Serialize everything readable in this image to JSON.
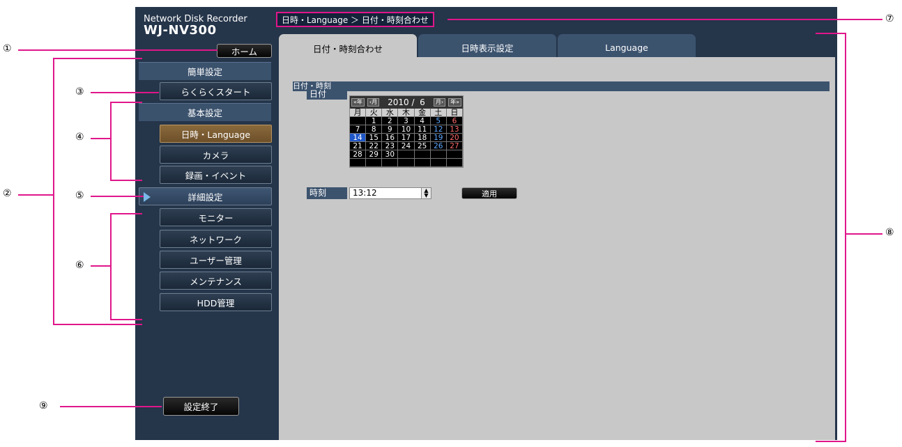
{
  "product": {
    "name": "Network Disk Recorder",
    "model": "WJ-NV300"
  },
  "breadcrumb": "日時・Language ＞ 日付・時刻合わせ",
  "home_button": "ホーム",
  "sidebar": {
    "cat_simple": "簡単設定",
    "quick_start": "らくらくスタート",
    "cat_basic": "基本設定",
    "datetime_language": "日時・Language",
    "camera": "カメラ",
    "recording_event": "録画・イベント",
    "cat_advanced": "詳細設定",
    "monitor": "モニター",
    "network": "ネットワーク",
    "user_management": "ユーザー管理",
    "maintenance": "メンテナンス",
    "hdd_management": "HDD管理"
  },
  "finish_button": "設定終了",
  "tabs": [
    "日付・時刻合わせ",
    "日時表示設定",
    "Language"
  ],
  "section_title": "日付・時刻",
  "date_label": "日付",
  "calendar": {
    "nav_prev_year": "«年",
    "nav_prev_month": "‹月",
    "year_month": "2010 /  6",
    "nav_next_month": "月›",
    "nav_next_year": "年»",
    "weekdays": [
      "月",
      "火",
      "水",
      "木",
      "金",
      "土",
      "日"
    ],
    "weeks": [
      [
        "",
        "1",
        "2",
        "3",
        "4",
        "5",
        "6"
      ],
      [
        "7",
        "8",
        "9",
        "10",
        "11",
        "12",
        "13"
      ],
      [
        "14",
        "15",
        "16",
        "17",
        "18",
        "19",
        "20"
      ],
      [
        "21",
        "22",
        "23",
        "24",
        "25",
        "26",
        "27"
      ],
      [
        "28",
        "29",
        "30",
        "",
        "",
        "",
        ""
      ],
      [
        "",
        "",
        "",
        "",
        "",
        "",
        ""
      ]
    ],
    "selected_day": "14"
  },
  "time_label": "時刻",
  "time_value": "13:12",
  "apply_button": "適用",
  "callouts": [
    "①",
    "②",
    "③",
    "④",
    "⑤",
    "⑥",
    "⑦",
    "⑧",
    "⑨"
  ],
  "colors": {
    "callout_line": "#e0168a",
    "screen_bg": "#25354a",
    "content_bg": "#c8c8c8",
    "active_item": "#7a5c33"
  }
}
